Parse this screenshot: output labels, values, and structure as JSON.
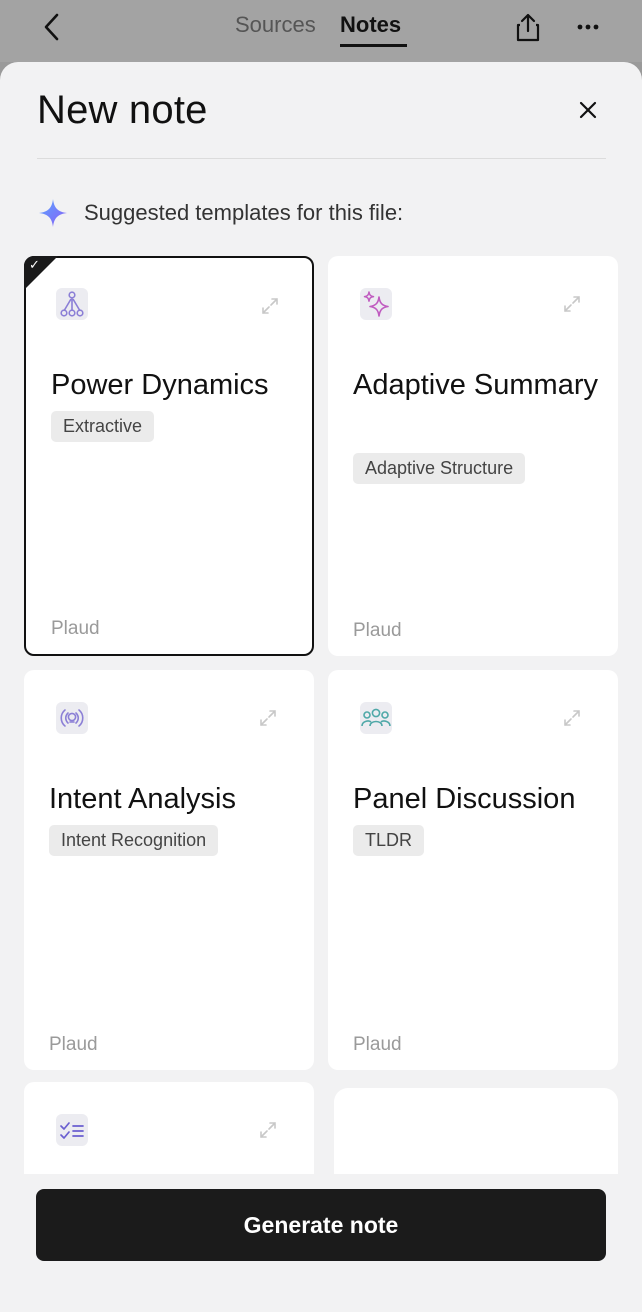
{
  "header": {
    "tabs": [
      {
        "label": "Sources",
        "active": false
      },
      {
        "label": "Notes",
        "active": true
      }
    ]
  },
  "sheet": {
    "title": "New note",
    "suggest_label": "Suggested templates for this file:"
  },
  "cards": [
    {
      "title": "Power Dynamics",
      "tag": "Extractive",
      "brand": "Plaud",
      "icon": "flow-branch-icon",
      "selected": true
    },
    {
      "title": "Adaptive Summary",
      "tag": "Adaptive Structure",
      "brand": "Plaud",
      "icon": "sparkles-icon",
      "selected": false
    },
    {
      "title": "Intent Analysis",
      "tag": "Intent Recognition",
      "brand": "Plaud",
      "icon": "broadcast-bulb-icon",
      "selected": false
    },
    {
      "title": "Panel Discussion",
      "tag": "TLDR",
      "brand": "Plaud",
      "icon": "people-group-icon",
      "selected": false
    },
    {
      "title": "",
      "tag": "",
      "brand": "",
      "icon": "checklist-icon",
      "selected": false
    }
  ],
  "actions": {
    "generate_label": "Generate note"
  },
  "colors": {
    "primary_button": "#1b1b1b",
    "sheet_background": "#f2f2f3",
    "card_background": "#ffffff",
    "accent_icon": "#8b7fd6"
  }
}
